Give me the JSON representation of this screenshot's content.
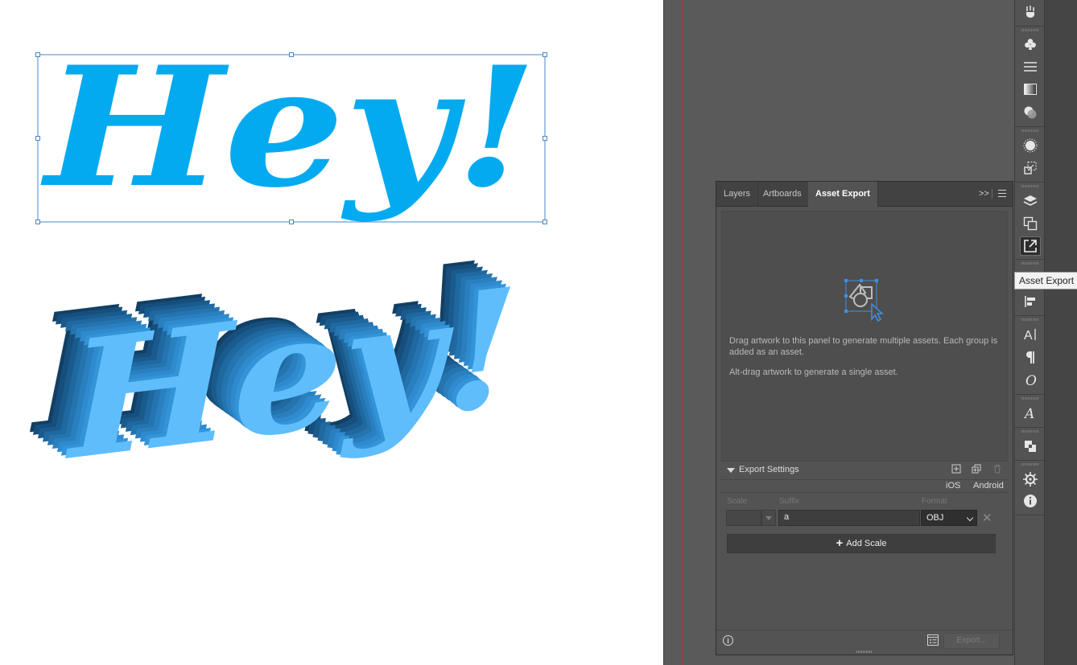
{
  "canvas": {
    "artwork_flat_text": "Hey!",
    "artwork_3d_text": "Hey!",
    "flat_color": "#04aaf0",
    "extrude_front_color": "#5fbdfb",
    "extrude_side_color": "#1f6aa3",
    "selection_color": "#4a86c8",
    "guide_color": "#c2302f"
  },
  "tooltip": {
    "text": "Asset Export"
  },
  "toolbar": {
    "icons": [
      "brush-icon",
      "club-symbol-icon",
      "stroke-lines-icon",
      "gradient-icon",
      "transparency-icon",
      "appearance-icon",
      "transform-icon",
      "layers-icon",
      "artboards-icon",
      "asset-export-icon",
      "align-icon",
      "character-icon",
      "paragraph-icon",
      "opentype-icon",
      "glyphs-icon",
      "pathfinder-icon",
      "properties-icon",
      "info-icon"
    ]
  },
  "panel": {
    "tabs": [
      {
        "label": "Layers",
        "active": false
      },
      {
        "label": "Artboards",
        "active": false
      },
      {
        "label": "Asset Export",
        "active": true
      }
    ],
    "collapse_label": ">>",
    "drag_help": "Drag artwork to this panel to generate multiple assets. Each group is added as an asset.",
    "alt_help": "Alt-drag artwork to generate a single asset.",
    "export_settings": {
      "label": "Export Settings",
      "presets": [
        "iOS",
        "Android"
      ],
      "columns": {
        "scale": "Scale",
        "suffix": "Suffix",
        "format": "Format"
      },
      "row": {
        "scale": "",
        "suffix": "a",
        "format": "OBJ"
      },
      "add_scale_label": "Add Scale",
      "export_label": "Export..."
    }
  }
}
